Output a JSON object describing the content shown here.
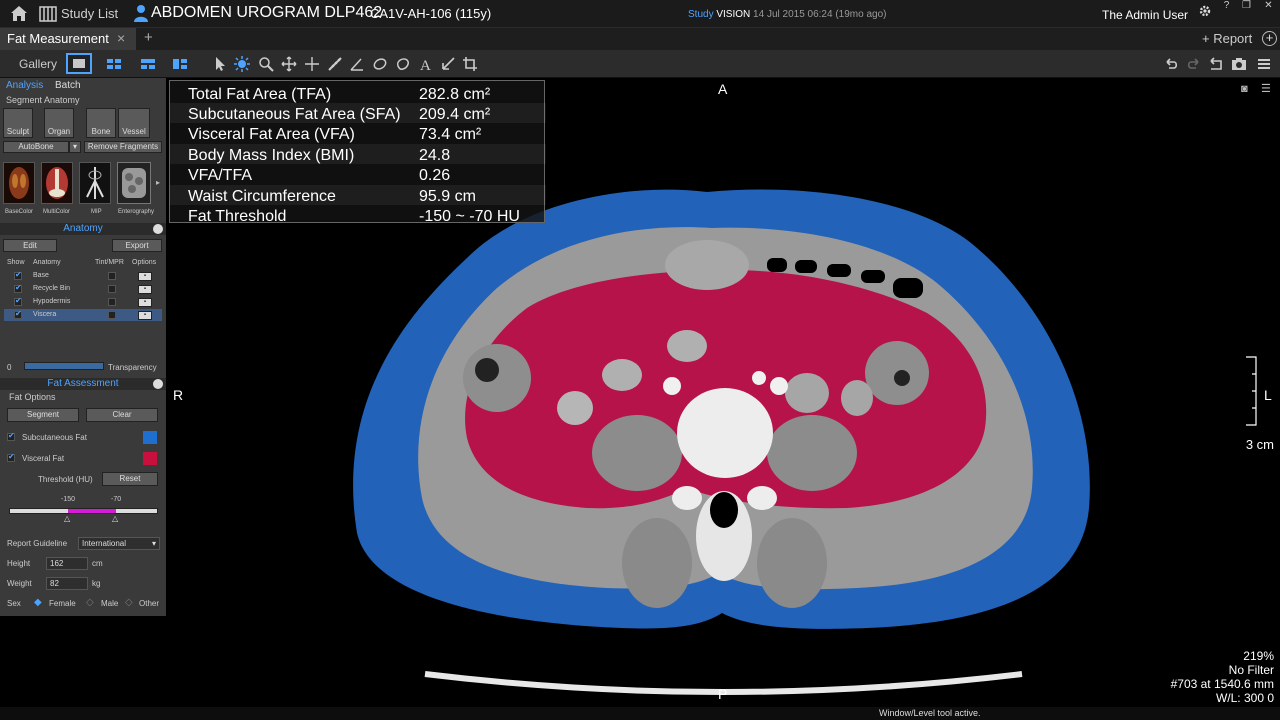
{
  "topbar": {
    "study_list": "Study List",
    "study_title": "ABDOMEN UROGRAM DLP462",
    "study_id": "CA1V-AH-106 (115y)",
    "date_label": "Study",
    "vision_label": "VISION",
    "date_value": "14 Jul 2015 06:24 (19mo ago)",
    "user": "The Admin User"
  },
  "tabs": {
    "active": "Fat Measurement",
    "close": "×",
    "add": "+",
    "report": "+ Report",
    "plus_circle": "+"
  },
  "toolbar": {
    "gallery": "Gallery"
  },
  "left_panel": {
    "tabs": [
      "Analysis",
      "Batch"
    ],
    "segment_anatomy": "Segment Anatomy",
    "seg_tools": [
      "Sculpt",
      "Organ",
      "Bone",
      "Vessel"
    ],
    "autobone": "AutoBone",
    "remove_fragments": "Remove Fragments",
    "thumbs": [
      "BaseColor",
      "MultiColor",
      "MIP",
      "Enterography"
    ],
    "anatomy_header": "Anatomy",
    "edit": "Edit",
    "export": "Export",
    "columns": [
      "Show",
      "Anatomy",
      "Tint/MPR",
      "Options"
    ],
    "anatomy_rows": [
      "Base",
      "Recycle Bin",
      "Hypodermis",
      "Viscera"
    ],
    "transparency_value": "0",
    "transparency_label": "Transparency",
    "fat_header": "Fat Assessment",
    "fat_options": "Fat Options",
    "segment_btn": "Segment",
    "clear_btn": "Clear",
    "subcutaneous": "Subcutaneous Fat",
    "visceral": "Visceral Fat",
    "threshold_label": "Threshold (HU)",
    "reset": "Reset",
    "thr_low": "-150",
    "thr_high": "-70",
    "report_guideline": "Report Guideline",
    "guideline_value": "International",
    "height_label": "Height",
    "height_value": "162",
    "height_unit": "cm",
    "weight_label": "Weight",
    "weight_value": "82",
    "weight_unit": "kg",
    "sex_label": "Sex",
    "sex_options": [
      "Female",
      "Male",
      "Other"
    ],
    "colors": {
      "subcutaneous": "#1f6fd1",
      "visceral": "#c8103f"
    }
  },
  "measurements": [
    {
      "key": "Total Fat Area (TFA)",
      "value": "282.8 cm²"
    },
    {
      "key": "Subcutaneous Fat Area (SFA)",
      "value": "209.4 cm²"
    },
    {
      "key": "Visceral Fat Area (VFA)",
      "value": "73.4 cm²"
    },
    {
      "key": "Body Mass Index (BMI)",
      "value": "24.8"
    },
    {
      "key": "VFA/TFA",
      "value": "0.26"
    },
    {
      "key": "Waist Circumference",
      "value": "95.9 cm"
    },
    {
      "key": "Fat Threshold",
      "value": "-150 ~ -70 HU"
    }
  ],
  "viewport": {
    "orient_top": "A",
    "orient_bottom": "P",
    "orient_left": "R",
    "orient_right": "L",
    "scale": "3 cm",
    "zoom": "219%",
    "filter": "No Filter",
    "slice": "#703 at 1540.6 mm",
    "wl": "W/L: 300 0"
  },
  "status": "Window/Level tool active."
}
